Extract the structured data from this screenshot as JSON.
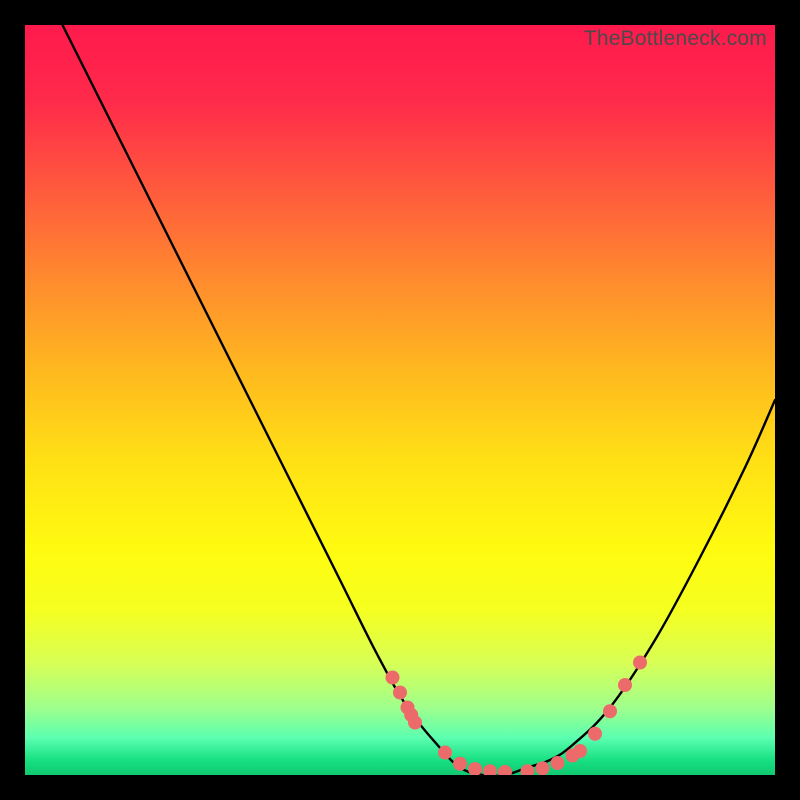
{
  "watermark": "TheBottleneck.com",
  "chart_data": {
    "type": "line",
    "title": "",
    "xlabel": "",
    "ylabel": "",
    "xlim": [
      0,
      100
    ],
    "ylim": [
      0,
      100
    ],
    "series": [
      {
        "name": "bottleneck-curve",
        "x": [
          5,
          12,
          20,
          28,
          36,
          42,
          47,
          51,
          55,
          58,
          61,
          64,
          67,
          70,
          73,
          78,
          84,
          90,
          96,
          100
        ],
        "y": [
          100,
          86,
          70,
          54,
          38,
          26,
          16,
          9,
          4,
          1,
          0,
          0,
          1,
          2,
          4,
          9,
          18,
          29,
          41,
          50
        ]
      }
    ],
    "dots": {
      "name": "highlight-points",
      "color": "#ed6a6a",
      "x": [
        49,
        50,
        51,
        52,
        51.5,
        56,
        58,
        60,
        62,
        64,
        67,
        69,
        71,
        73,
        74,
        76,
        78,
        80,
        82
      ],
      "y": [
        13,
        11,
        9,
        7,
        8,
        3,
        1.5,
        0.8,
        0.5,
        0.4,
        0.5,
        0.9,
        1.6,
        2.6,
        3.2,
        5.5,
        8.5,
        12,
        15
      ]
    }
  }
}
